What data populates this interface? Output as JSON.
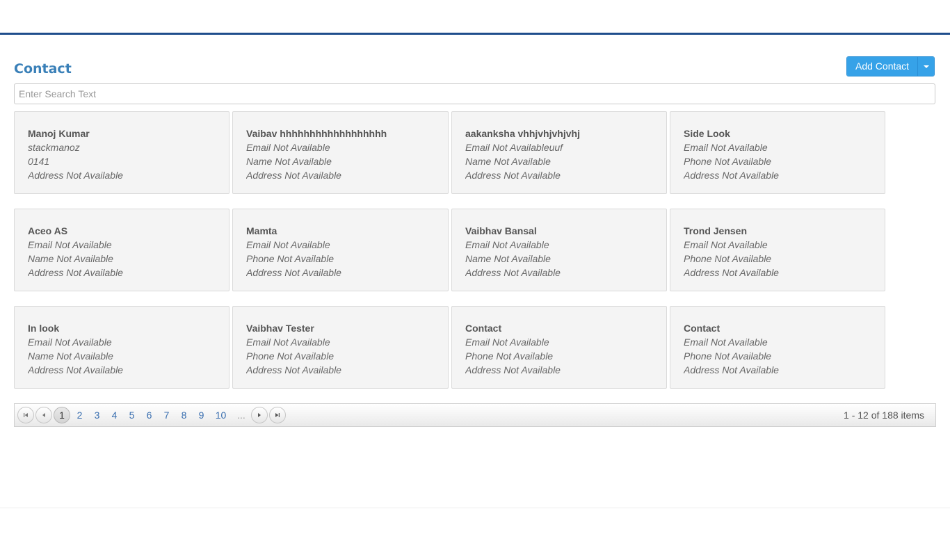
{
  "header": {
    "title": "Contact"
  },
  "toolbar": {
    "add_label": "Add Contact"
  },
  "search": {
    "placeholder": "Enter Search Text",
    "value": ""
  },
  "contacts": [
    {
      "name": "Manoj Kumar",
      "line1": "stackmanoz",
      "line2": "0141",
      "line3": "Address Not Available"
    },
    {
      "name": "Vaibav hhhhhhhhhhhhhhhhhh",
      "line1": "Email Not Available",
      "line2": "Name Not Available",
      "line3": "Address Not Available"
    },
    {
      "name": "aakanksha vhhjvhjvhjvhj",
      "line1": "Email Not Availableuuf",
      "line2": "Name Not Available",
      "line3": "Address Not Available"
    },
    {
      "name": "Side Look",
      "line1": "Email Not Available",
      "line2": "Phone Not Available",
      "line3": "Address Not Available"
    },
    {
      "name": "Aceo AS",
      "line1": "Email Not Available",
      "line2": "Name Not Available",
      "line3": "Address Not Available"
    },
    {
      "name": "Mamta",
      "line1": "Email Not Available",
      "line2": "Phone Not Available",
      "line3": "Address Not Available"
    },
    {
      "name": "Vaibhav Bansal",
      "line1": "Email Not Available",
      "line2": "Name Not Available",
      "line3": "Address Not Available"
    },
    {
      "name": "Trond Jensen",
      "line1": "Email Not Available",
      "line2": "Phone Not Available",
      "line3": "Address Not Available"
    },
    {
      "name": "In look",
      "line1": "Email Not Available",
      "line2": "Name Not Available",
      "line3": "Address Not Available"
    },
    {
      "name": "Vaibhav Tester",
      "line1": "Email Not Available",
      "line2": "Phone Not Available",
      "line3": "Address Not Available"
    },
    {
      "name": "Contact",
      "line1": "Email Not Available",
      "line2": "Phone Not Available",
      "line3": "Address Not Available"
    },
    {
      "name": "Contact",
      "line1": "Email Not Available",
      "line2": "Phone Not Available",
      "line3": "Address Not Available"
    }
  ],
  "pager": {
    "pages": [
      "1",
      "2",
      "3",
      "4",
      "5",
      "6",
      "7",
      "8",
      "9",
      "10"
    ],
    "current": "1",
    "more": "...",
    "info": "1 - 12 of 188 items"
  },
  "colors": {
    "accent": "#36a2e8",
    "title": "#3a80b8",
    "topbar_border": "#1f4e8c"
  },
  "icons": {
    "first": "seek-first-icon",
    "prev": "arrow-left-icon",
    "next": "arrow-right-icon",
    "last": "seek-last-icon",
    "dropdown": "caret-down-icon"
  }
}
